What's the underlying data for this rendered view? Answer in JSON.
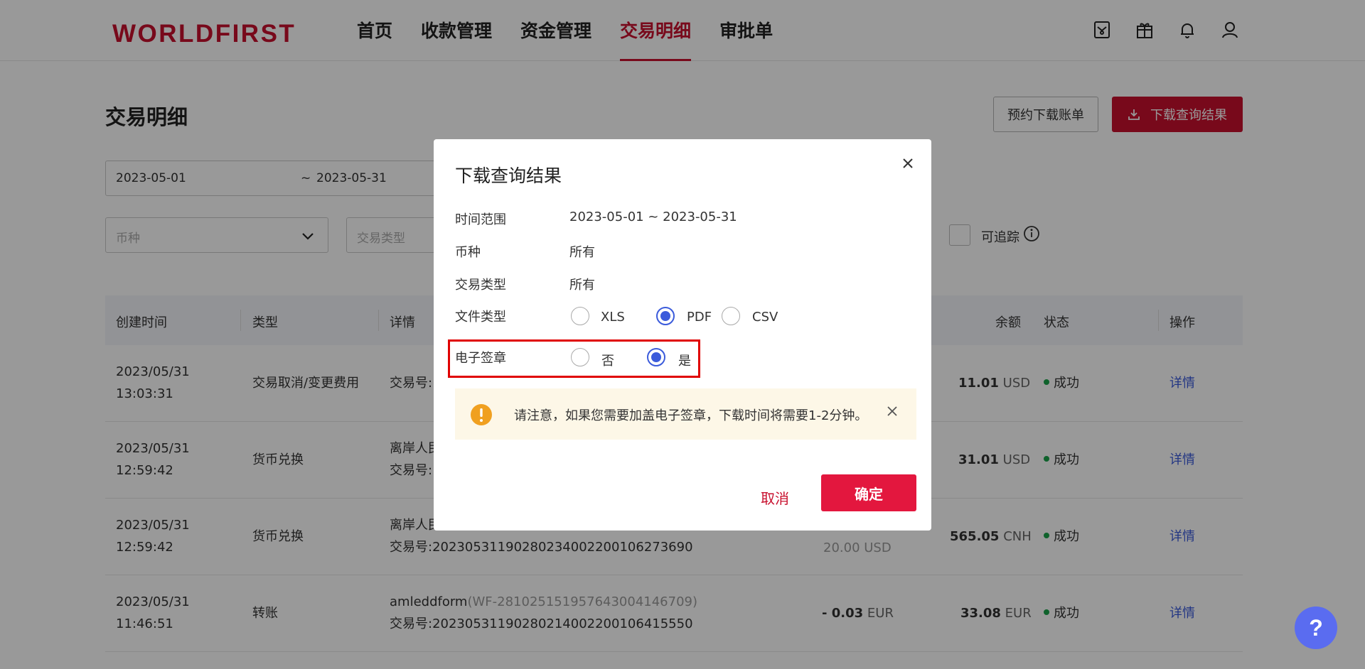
{
  "header": {
    "logo": "WORLDFIRST",
    "nav": [
      "首页",
      "收款管理",
      "资金管理",
      "交易明细",
      "审批单"
    ],
    "active_nav": "交易明细"
  },
  "page": {
    "title": "交易明细",
    "schedule_button": "预约下载账单",
    "download_button": "下载查询结果"
  },
  "filters": {
    "date_start": "2023-05-01",
    "date_sep": "~",
    "date_end": "2023-05-31",
    "currency_placeholder": "币种",
    "type_placeholder": "交易类型",
    "trackable_label": "可追踪"
  },
  "table": {
    "headers": [
      "创建时间",
      "类型",
      "详情",
      "余额",
      "状态",
      "操作"
    ],
    "rows": [
      {
        "date": "2023/05/31",
        "time": "13:03:31",
        "type": "交易取消/变更费用",
        "detail_line1": "交易号:",
        "detail_line2": "",
        "amount": "",
        "amount_cur": "",
        "amount2": "",
        "balance": "11.01",
        "balance_cur": "USD",
        "status": "成功",
        "action": "详情"
      },
      {
        "date": "2023/05/31",
        "time": "12:59:42",
        "type": "货币兑换",
        "detail_line1": "离岸人民",
        "detail_line2": "交易号:",
        "amount": "",
        "amount_cur": "",
        "amount2": "",
        "balance": "31.01",
        "balance_cur": "USD",
        "status": "成功",
        "action": "详情"
      },
      {
        "date": "2023/05/31",
        "time": "12:59:42",
        "type": "货币兑换",
        "detail_line1": "离岸人民",
        "detail_line2": "交易号:20230531190280234002200106273690",
        "amount": "",
        "amount_cur": "",
        "amount2": "20.00 USD",
        "balance": "565.05",
        "balance_cur": "CNH",
        "status": "成功",
        "action": "详情"
      },
      {
        "date": "2023/05/31",
        "time": "11:46:51",
        "type": "转账",
        "detail_line1": "amleddform",
        "detail_ref": "(WF-2810251519576430041467​09)",
        "detail_line2": "交易号:20230531190280214002200106415550",
        "amount": "- 0.03",
        "amount_cur": "EUR",
        "amount2": "",
        "balance": "33.08",
        "balance_cur": "EUR",
        "status": "成功",
        "action": "详情"
      }
    ]
  },
  "modal": {
    "title": "下载查询结果",
    "time_range_label": "时间范围",
    "time_range_value": "2023-05-01 ~ 2023-05-31",
    "currency_label": "币种",
    "currency_value": "所有",
    "type_label": "交易类型",
    "type_value": "所有",
    "file_type_label": "文件类型",
    "file_types": [
      "XLS",
      "PDF",
      "CSV"
    ],
    "file_type_selected": "PDF",
    "esign_label": "电子签章",
    "esign_options": [
      "否",
      "是"
    ],
    "esign_selected": "是",
    "notice": "请注意，如果您需要加盖电子签章，下载时间将需要1-2分钟。",
    "cancel": "取消",
    "confirm": "确定"
  },
  "help": "?",
  "colors": {
    "brand": "#c8102e",
    "primary_button": "#e3173e",
    "radio": "#3b5bdb",
    "notice_bg": "#fdf7e7",
    "notice_icon": "#f0a020",
    "help": "#5a6cf0",
    "highlight": "#e00000"
  }
}
